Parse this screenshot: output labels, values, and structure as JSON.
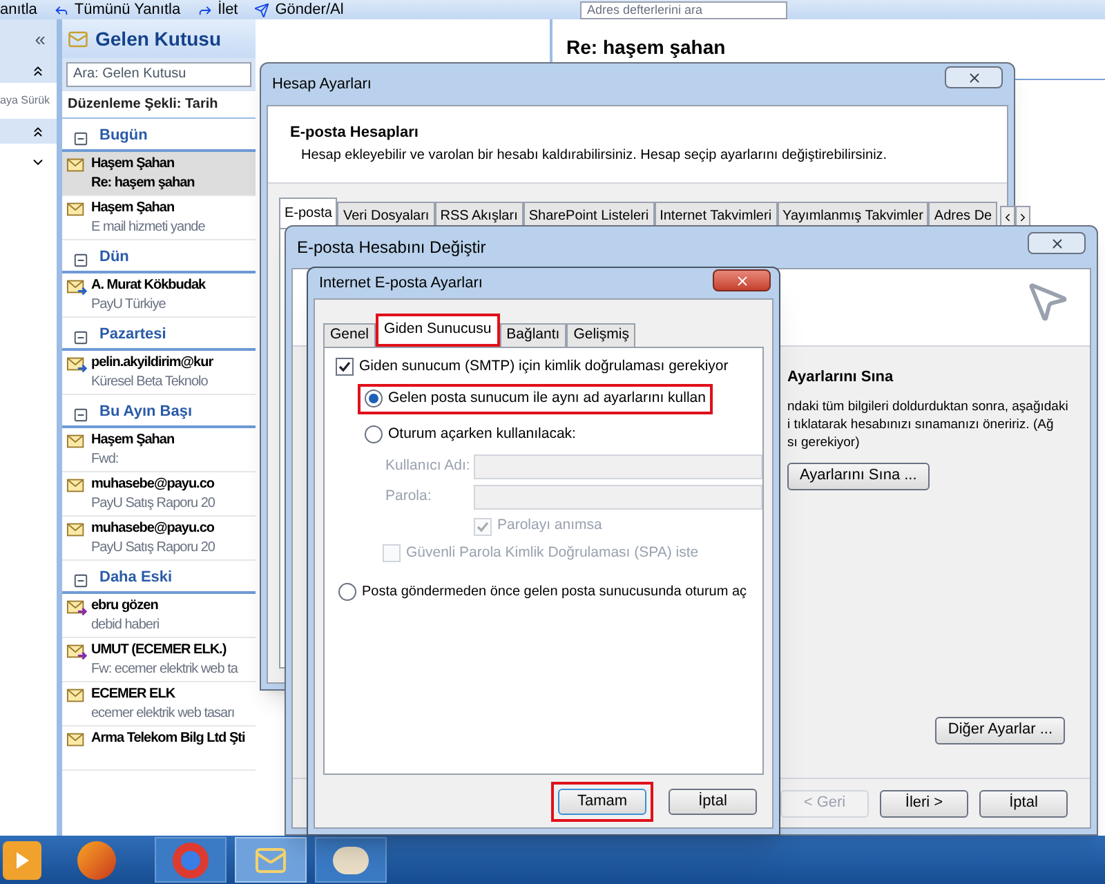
{
  "toolbar": {
    "buttons": [
      {
        "label": "anıtla"
      },
      {
        "label": "Tümünü Yanıtla"
      },
      {
        "label": "İlet"
      },
      {
        "label": "Gönder/Al"
      }
    ],
    "search": {
      "placeholder": "Adres defterlerini ara"
    }
  },
  "nav_pane": {
    "collapse": "«",
    "drag_hint": "aya Sürük"
  },
  "mail_list": {
    "title": "Gelen Kutusu",
    "search": {
      "placeholder": "Ara: Gelen Kutusu"
    },
    "arrange_by": "Düzenleme Şekli: Tarih",
    "groups": [
      {
        "label": "Bugün",
        "items": [
          {
            "sender": "Haşem Şahan",
            "subject": "Re: haşem şahan",
            "kind": "read",
            "selected": true
          },
          {
            "sender": "Haşem Şahan",
            "subject": "E mail hizmeti yande",
            "kind": "read",
            "selected": false
          }
        ]
      },
      {
        "label": "Dün",
        "items": [
          {
            "sender": "A. Murat Kökbudak",
            "subject": "PayU Türkiye",
            "kind": "replied",
            "selected": false
          }
        ]
      },
      {
        "label": "Pazartesi",
        "items": [
          {
            "sender": "pelin.akyildirim@kur",
            "subject": "Küresel Beta Teknolo",
            "kind": "replied",
            "selected": false
          }
        ]
      },
      {
        "label": "Bu Ayın Başı",
        "items": [
          {
            "sender": "Haşem Şahan",
            "subject": "Fwd:",
            "kind": "read",
            "selected": false
          },
          {
            "sender": "muhasebe@payu.co",
            "subject": "PayU Satış Raporu 20",
            "kind": "read",
            "selected": false
          },
          {
            "sender": "muhasebe@payu.co",
            "subject": "PayU Satış Raporu 20",
            "kind": "read",
            "selected": false
          }
        ]
      },
      {
        "label": "Daha Eski",
        "items": [
          {
            "sender": "ebru gözen",
            "subject": "debid haberi",
            "kind": "forwarded",
            "selected": false
          },
          {
            "sender": "UMUT (ECEMER ELK.)",
            "subject": "Fw: ecemer elektrik web ta",
            "kind": "forwarded",
            "selected": false
          },
          {
            "sender": "ECEMER ELK",
            "subject": "ecemer elektrik web tasarı",
            "kind": "read",
            "selected": false
          },
          {
            "sender": "Arma Telekom Bilg Ltd Şti",
            "kind": "read",
            "selected": false
          }
        ]
      }
    ]
  },
  "reading_pane": {
    "subject": "Re: haşem şahan"
  },
  "account_settings": {
    "title": "Hesap Ayarları",
    "heading": "E-posta Hesapları",
    "description": "Hesap ekleyebilir ve varolan bir hesabı kaldırabilirsiniz. Hesap seçip ayarlarını değiştirebilirsiniz.",
    "tabs": [
      {
        "label": "E-posta",
        "selected": true
      },
      {
        "label": "Veri Dosyaları",
        "selected": false
      },
      {
        "label": "RSS Akışları",
        "selected": false
      },
      {
        "label": "SharePoint Listeleri",
        "selected": false
      },
      {
        "label": "Internet Takvimleri",
        "selected": false
      },
      {
        "label": "Yayımlanmış Takvimler",
        "selected": false
      },
      {
        "label": "Adres De",
        "selected": false
      }
    ]
  },
  "change_account": {
    "title": "E-posta Hesabını Değiştir",
    "test_heading": "Ayarlarını Sına",
    "test_text": [
      "ndaki tüm bilgileri doldurduktan sonra, aşağıdaki",
      "i tıklatarak hesabınızı sınamanızı öneririz. (Ağ",
      "sı gerekiyor)"
    ],
    "test_button": "Ayarlarını Sına ...",
    "more_button": "Diğer Ayarlar ...",
    "buttons": [
      {
        "label": "< Geri",
        "disabled": true
      },
      {
        "label": "İleri >",
        "disabled": false
      },
      {
        "label": "İptal",
        "disabled": false
      }
    ]
  },
  "internet_settings": {
    "title": "Internet E-posta Ayarları",
    "tabs": [
      {
        "label": "Genel",
        "selected": false,
        "highlighted": false
      },
      {
        "label": "Giden Sunucusu",
        "selected": true,
        "highlighted": true
      },
      {
        "label": "Bağlantı",
        "selected": false,
        "highlighted": false
      },
      {
        "label": "Gelişmiş",
        "selected": false,
        "highlighted": false
      }
    ],
    "smtp_auth": {
      "label": "Giden sunucum (SMTP) için kimlik doğrulaması gerekiyor",
      "checked": true
    },
    "options": [
      {
        "label": "Gelen posta sunucum ile aynı ad ayarlarını kullan",
        "selected": true,
        "highlighted": true
      },
      {
        "label": "Oturum açarken kullanılacak:",
        "selected": false,
        "highlighted": false
      }
    ],
    "username": {
      "label": "Kullanıcı Adı:",
      "disabled": true
    },
    "password": {
      "label": "Parola:",
      "disabled": true
    },
    "remember": {
      "label": "Parolayı anımsa",
      "checked": true,
      "disabled": true
    },
    "spa": {
      "label": "Güvenli Parola Kimlik Doğrulaması (SPA) iste",
      "checked": false,
      "disabled": true
    },
    "pop_before": {
      "label": "Posta göndermeden önce gelen posta sunucusunda oturum aç",
      "selected": false
    },
    "buttons": [
      {
        "label": "Tamam",
        "highlighted": true
      },
      {
        "label": "İptal",
        "highlighted": false
      }
    ]
  }
}
